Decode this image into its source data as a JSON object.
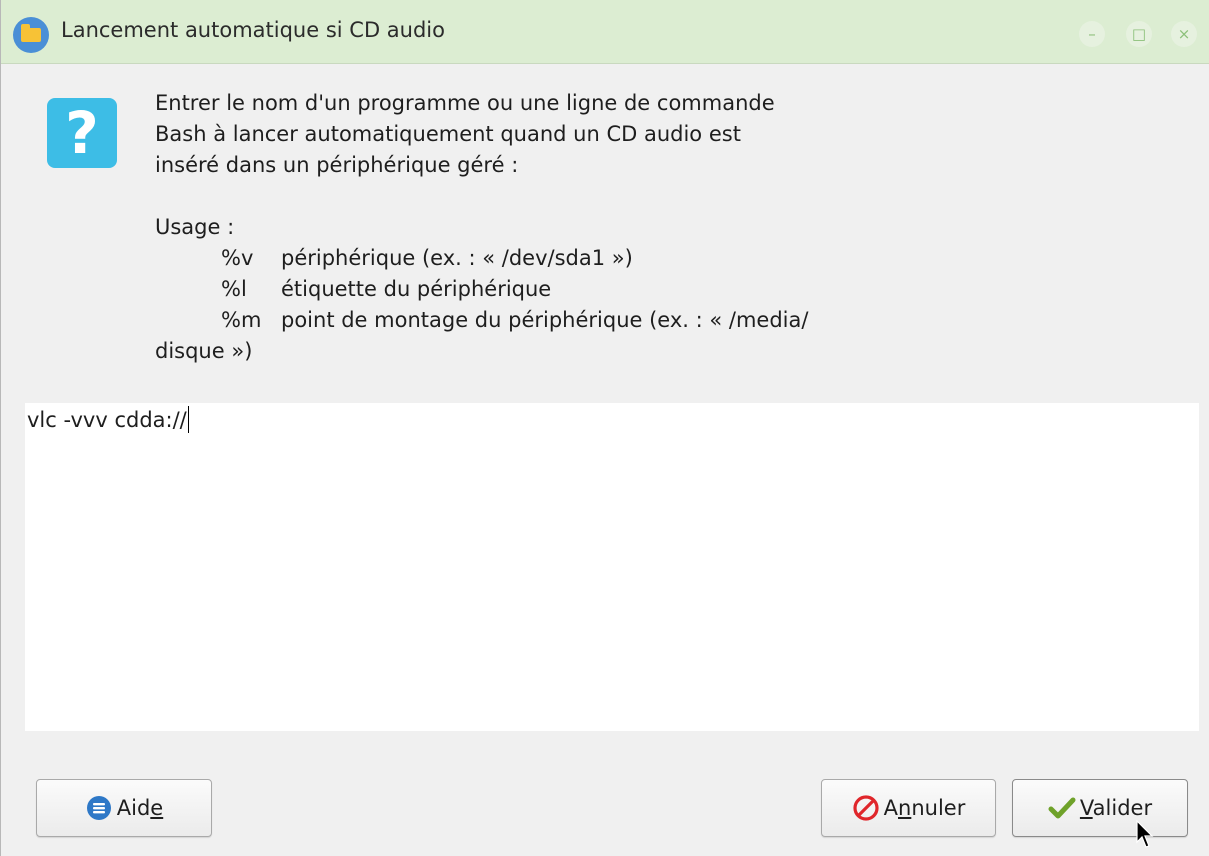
{
  "window": {
    "title": "Lancement automatique si CD audio",
    "controls": {
      "minimize": "–",
      "maximize": "□",
      "close": "×"
    }
  },
  "dialog": {
    "icon": "question-icon",
    "message_lines": [
      "Entrer le nom d'un programme ou une ligne de commande",
      "Bash à lancer automatiquement quand un CD audio est",
      "inséré dans un périphérique géré :"
    ],
    "usage_title": "Usage :",
    "usage_items": [
      {
        "code": "%v",
        "desc": "périphérique (ex. : « /dev/sda1 »)"
      },
      {
        "code": "%l",
        "desc": "étiquette du périphérique"
      },
      {
        "code": "%m",
        "desc": "point de montage du périphérique (ex. : « /media/"
      }
    ],
    "usage_wrap": "disque »)",
    "command_value": "vlc -vvv cdda://"
  },
  "buttons": {
    "help": {
      "pre": "Aid",
      "mnemonic": "e",
      "post": ""
    },
    "cancel": {
      "pre": "A",
      "mnemonic": "n",
      "post": "nuler"
    },
    "ok": {
      "pre": "",
      "mnemonic": "V",
      "post": "alider"
    }
  },
  "colors": {
    "titlebar": "#dcedd2",
    "question_icon": "#3dbde6",
    "help_icon": "#2e78c7",
    "cancel_icon": "#e0262b",
    "ok_icon": "#6fa22a"
  }
}
